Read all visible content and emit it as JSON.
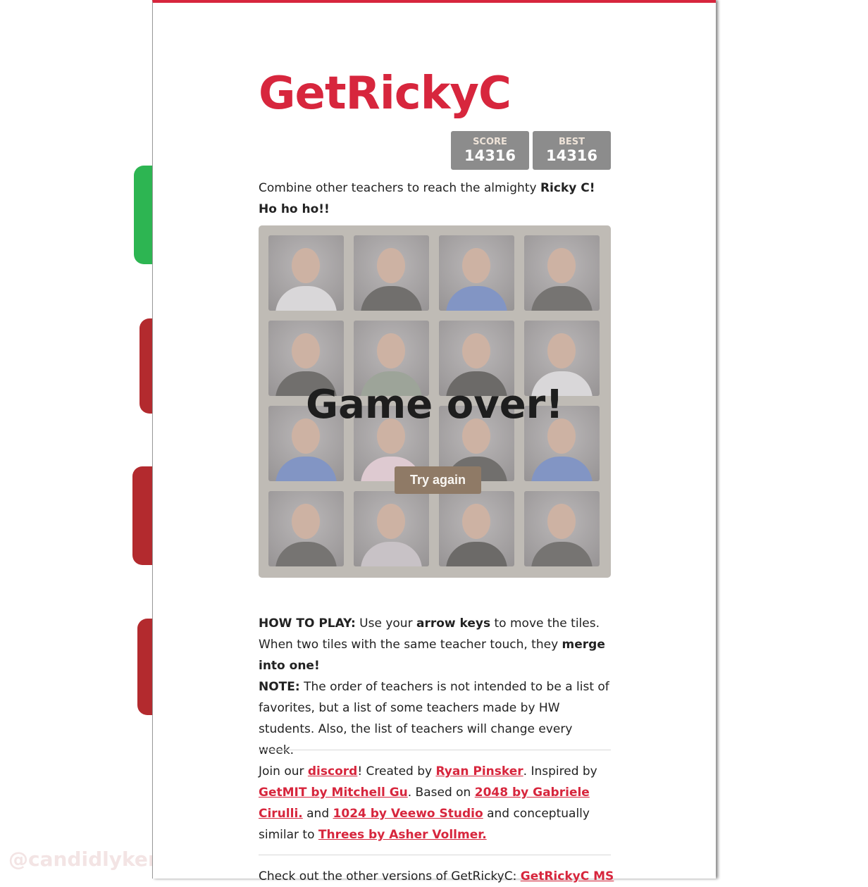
{
  "title": "GetRickyC",
  "score": {
    "label": "SCORE",
    "value": "14316"
  },
  "best": {
    "label": "BEST",
    "value": "14316"
  },
  "intro": {
    "text": "Combine other teachers to reach the almighty ",
    "bold": "Ricky C! Ho ho ho!!"
  },
  "board": {
    "tiles": [
      "teacher-photo",
      "teacher-photo",
      "teacher-photo",
      "teacher-photo",
      "teacher-photo",
      "teacher-photo",
      "teacher-photo",
      "teacher-photo",
      "teacher-photo",
      "teacher-photo",
      "teacher-photo",
      "teacher-photo",
      "teacher-photo",
      "teacher-photo",
      "teacher-photo",
      "teacher-photo"
    ],
    "game_over": "Game over!",
    "try_again": "Try again"
  },
  "howto": {
    "h": "HOW TO PLAY:",
    "t1": " Use your ",
    "b1": "arrow keys",
    "t2": " to move the tiles. When two tiles with the same teacher touch, they ",
    "b2": "merge into one!",
    "note_h": "NOTE:",
    "note": " The order of teachers is not intended to be a list of favorites, but a list of some teachers made by HW students. Also, the list of teachers will change every week."
  },
  "credits": {
    "t1": "Join our ",
    "l1": "discord",
    "t2": "! Created by ",
    "l2": "Ryan Pinsker",
    "t3": ". Inspired by ",
    "l3": "GetMIT by Mitchell Gu",
    "t4": ". Based on ",
    "l4": "2048 by Gabriele Cirulli.",
    "t5": " and ",
    "l5": "1024 by Veewo Studio",
    "t6": " and conceptually similar to ",
    "l6": "Threes by Asher Vollmer."
  },
  "other": {
    "text": "Check out the other versions of GetRickyC: ",
    "link": "GetRickyC MS"
  },
  "watermark": "@candidlykeri",
  "colors": {
    "accent": "#d7263d",
    "score_bg": "#8c8c8c",
    "button": "#8f7a66",
    "deco_green": "#2db552",
    "deco_red": "#b32a2e"
  }
}
